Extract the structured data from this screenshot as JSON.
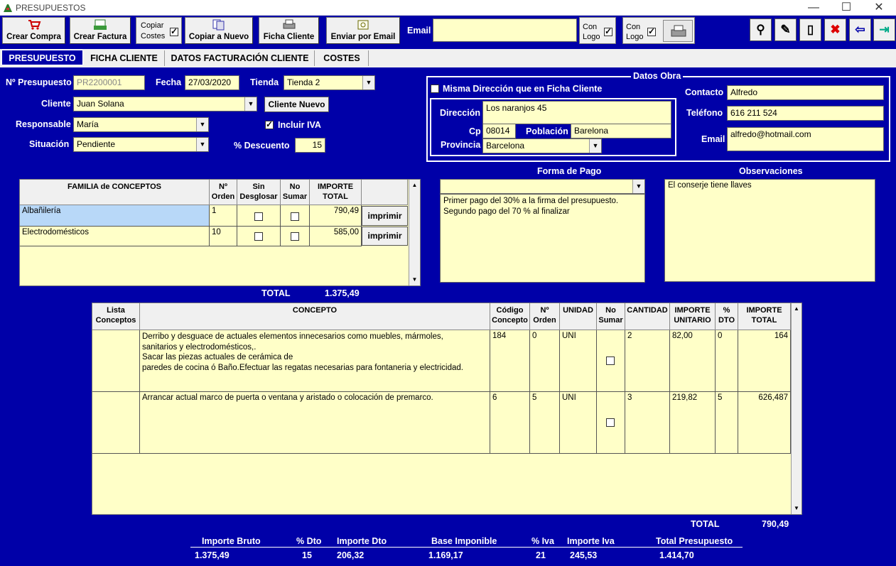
{
  "window": {
    "title": "PRESUPUESTOS",
    "minimize": "—",
    "maximize": "☐",
    "close": "✕"
  },
  "toolbar": {
    "crear_compra": "Crear Compra",
    "crear_factura": "Crear Factura",
    "copiar_costes_line1": "Copiar",
    "copiar_costes_line2": "Costes",
    "copiar_nuevo": "Copiar a Nuevo",
    "ficha_cliente": "Ficha Cliente",
    "enviar_email": "Enviar por Email",
    "email_label": "Email",
    "email_value": "",
    "con_logo1_line1": "Con",
    "con_logo1_line2": "Logo",
    "con_logo2_line1": "Con",
    "con_logo2_line2": "Logo"
  },
  "tabs": [
    "PRESUPUESTO",
    "FICHA CLIENTE",
    "DATOS FACTURACIÓN CLIENTE",
    "COSTES"
  ],
  "form": {
    "presupuesto_label": "Nº Presupuesto",
    "presupuesto_value": "PR2200001",
    "fecha_label": "Fecha",
    "fecha_value": "27/03/2020",
    "tienda_label": "Tienda",
    "tienda_value": "Tienda 2",
    "cliente_label": "Cliente",
    "cliente_value": "Juan Solana",
    "cliente_nuevo": "Cliente Nuevo",
    "responsable_label": "Responsable",
    "responsable_value": "María",
    "incluir_iva": "Incluir IVA",
    "situacion_label": "Situación",
    "situacion_value": "Pendiente",
    "descuento_label": "% Descuento",
    "descuento_value": "15"
  },
  "obra": {
    "legend": "Datos Obra",
    "misma_direccion": "Misma Dirección que en Ficha Cliente",
    "direccion_label": "Dirección",
    "direccion_value": "Los naranjos 45",
    "cp_label": "Cp",
    "cp_value": "08014",
    "poblacion_label": "Población",
    "poblacion_value": "Barelona",
    "provincia_label": "Provincia",
    "provincia_value": "Barcelona",
    "contacto_label": "Contacto",
    "contacto_value": "Alfredo",
    "telefono_label": "Teléfono",
    "telefono_value": "616 211 524",
    "email_label": "Email",
    "email_value": "alfredo@hotmail.com"
  },
  "familias": {
    "headers": [
      "FAMILIA de CONCEPTOS",
      "Nº Orden",
      "Sin Desglosar",
      "No Sumar",
      "IMPORTE TOTAL"
    ],
    "rows": [
      {
        "familia": "Albañilería",
        "orden": "1",
        "importe": "790,49",
        "boton": "imprimir"
      },
      {
        "familia": "Electrodomésticos",
        "orden": "10",
        "importe": "585,00",
        "boton": "imprimir"
      }
    ],
    "total_label": "TOTAL",
    "total_value": "1.375,49"
  },
  "pago": {
    "label": "Forma de Pago",
    "text": "Primer pago del 30% a la firma del presupuesto.\nSegundo pago del 70 % al finalizar"
  },
  "observaciones": {
    "label": "Observaciones",
    "text": "El conserje tiene llaves"
  },
  "conceptos": {
    "headers": [
      "Lista Conceptos",
      "CONCEPTO",
      "Código Concepto",
      "Nº Orden",
      "UNIDAD",
      "No Sumar",
      "CANTIDAD",
      "IMPORTE UNITARIO",
      "% DTO",
      "IMPORTE TOTAL"
    ],
    "rows": [
      {
        "concepto": "Derribo y desguace de actuales elementos innecesarios como muebles, mármoles,\nsanitarios y electrodomésticos,.\nSacar las piezas actuales de cerámica de\nparedes de cocina ó Baño.Efectuar las regatas necesarias para fontaneria y electricidad.",
        "codigo": "184",
        "orden": "0",
        "unidad": "UNI",
        "cantidad": "2",
        "unitario": "82,00",
        "dto": "0",
        "total": "164"
      },
      {
        "concepto": "Arrancar actual marco de puerta o ventana y aristado o colocación de premarco.",
        "codigo": "6",
        "orden": "5",
        "unidad": "UNI",
        "cantidad": "3",
        "unitario": "219,82",
        "dto": "5",
        "total": "626,487"
      }
    ],
    "total_label": "TOTAL",
    "total_value": "790,49"
  },
  "resumen": {
    "labels": [
      "Importe Bruto",
      "% Dto",
      "Importe Dto",
      "Base Imponible",
      "% Iva",
      "Importe Iva",
      "Total Presupuesto"
    ],
    "values": [
      "1.375,49",
      "15",
      "206,32",
      "1.169,17",
      "21",
      "245,53",
      "1.414,70"
    ]
  }
}
